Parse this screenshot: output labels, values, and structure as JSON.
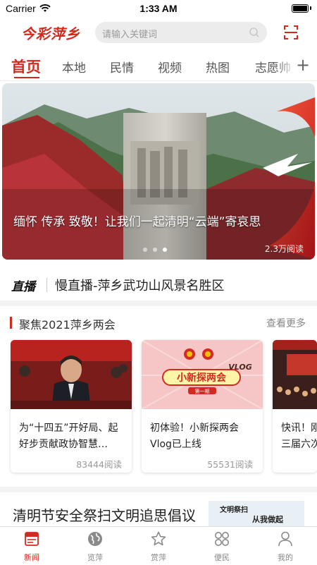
{
  "status_bar": {
    "carrier": "Carrier",
    "time": "1:33 AM"
  },
  "header": {
    "logo_text": "今彩萍乡",
    "search_placeholder": "请输入关键词"
  },
  "tabs": [
    {
      "label": "首页",
      "active": true
    },
    {
      "label": "本地"
    },
    {
      "label": "民情"
    },
    {
      "label": "视频"
    },
    {
      "label": "热图"
    },
    {
      "label": "志愿帅"
    }
  ],
  "banner": {
    "caption": "缅怀 传承 致敬！让我们一起清明“云端”寄哀思",
    "reads": "2.3万阅读",
    "page_count": 3,
    "active_index": 2
  },
  "live": {
    "badge": "直播",
    "title": "慢直播-萍乡武功山风景名胜区"
  },
  "focus": {
    "title": "聚焦2021萍乡两会",
    "more": "查看更多",
    "cards": [
      {
        "title": "为“十四五”开好局、起好步贡献政协智慧…",
        "reads": "83444阅读"
      },
      {
        "title": "初体验！小新探两会Vlog已上线",
        "reads": "55531阅读",
        "img_text_main": "小新探两会",
        "img_text_vlog": "VLOG",
        "img_text_issue": "第一期"
      },
      {
        "title": "快讯！刚三届六次",
        "reads": ""
      }
    ]
  },
  "article": {
    "title": "清明节安全祭扫文明追思倡议",
    "thumb_text1": "文明祭扫",
    "thumb_text2": "从我做起"
  },
  "tabbar": [
    {
      "label": "新闻",
      "icon": "news-icon",
      "active": true
    },
    {
      "label": "览萍",
      "icon": "globe-icon"
    },
    {
      "label": "赏萍",
      "icon": "star-icon"
    },
    {
      "label": "便民",
      "icon": "grid-icon"
    },
    {
      "label": "我的",
      "icon": "person-icon"
    }
  ],
  "colors": {
    "brand": "#d32a1f"
  }
}
